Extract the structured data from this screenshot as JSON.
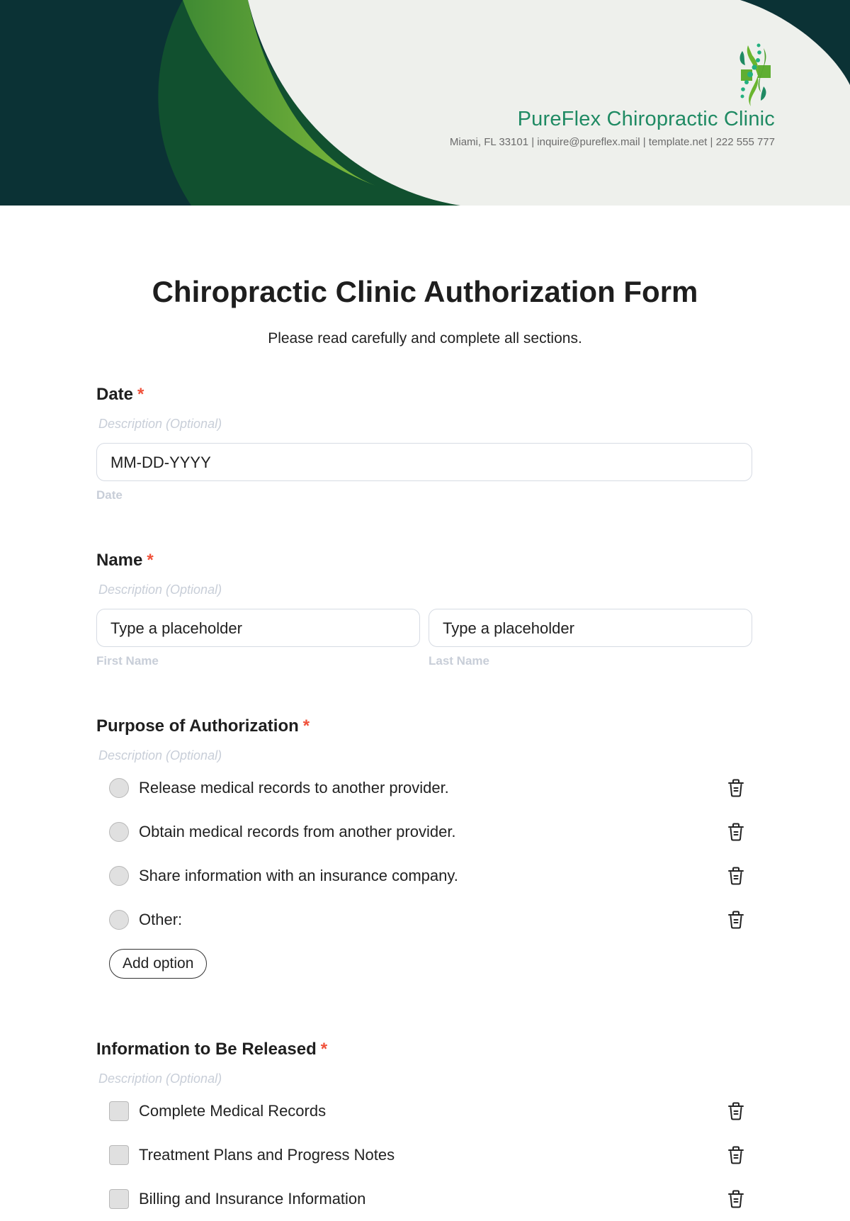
{
  "header": {
    "clinic_name": "PureFlex Chiropractic Clinic",
    "clinic_info": "Miami, FL 33101 | inquire@pureflex.mail | template.net | 222 555 777",
    "colors": {
      "dark": "#0b3235",
      "green_dark": "#11502f",
      "green_light": "#7ab83b",
      "cream": "#eef0ec",
      "brand_text": "#1f8a63"
    }
  },
  "form": {
    "title": "Chiropractic Clinic Authorization Form",
    "subtitle": "Please read carefully and complete all sections.",
    "required_mark": "*",
    "description_placeholder": "Description (Optional)",
    "date": {
      "label": "Date",
      "placeholder": "MM-DD-YYYY",
      "sub_label": "Date"
    },
    "name": {
      "label": "Name",
      "first_placeholder": "Type a placeholder",
      "last_placeholder": "Type a placeholder",
      "first_sub_label": "First Name",
      "last_sub_label": "Last Name"
    },
    "purpose": {
      "label": "Purpose of Authorization",
      "options": [
        "Release medical records to another provider.",
        "Obtain medical records from another provider.",
        "Share information with an insurance company.",
        "Other:"
      ],
      "add_option_label": "Add option"
    },
    "info_released": {
      "label": "Information to Be Released",
      "options": [
        "Complete Medical Records",
        "Treatment Plans and Progress Notes",
        "Billing and Insurance Information"
      ]
    }
  }
}
